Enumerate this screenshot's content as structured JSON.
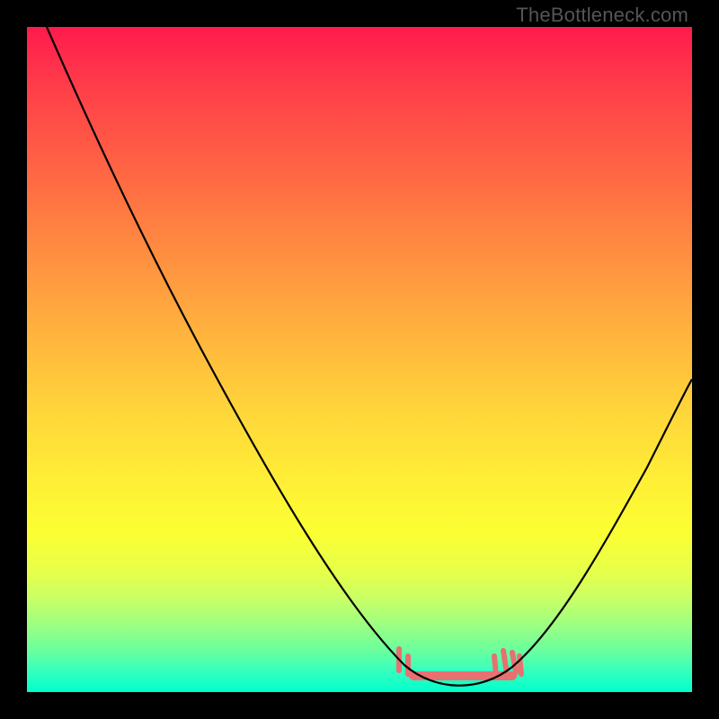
{
  "watermark": "TheBottleneck.com",
  "chart_data": {
    "type": "line",
    "title": "",
    "xlabel": "",
    "ylabel": "",
    "xlim": [
      0,
      100
    ],
    "ylim": [
      0,
      100
    ],
    "series": [
      {
        "name": "bottleneck-curve",
        "x": [
          3,
          10,
          20,
          30,
          40,
          50,
          55,
          58,
          60,
          65,
          70,
          72,
          76,
          82,
          90,
          100
        ],
        "y": [
          100,
          85,
          68,
          51,
          35,
          18,
          9,
          4,
          2,
          1,
          1,
          2,
          5,
          13,
          27,
          47
        ]
      }
    ],
    "highlight_band": {
      "name": "optimal-range",
      "x_start": 56,
      "x_end": 73,
      "color": "#e97070"
    },
    "background_gradient": {
      "top": "#ff1a4d",
      "bottom": "#00ffcc"
    }
  }
}
